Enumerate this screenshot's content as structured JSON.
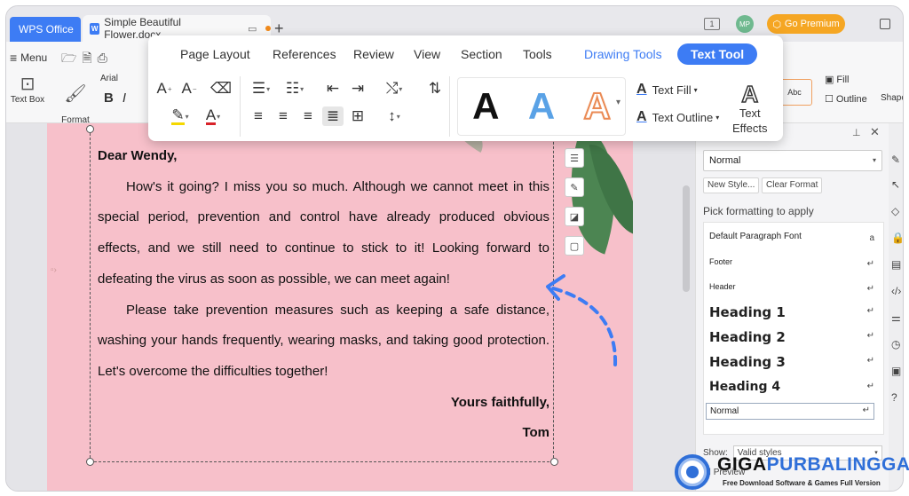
{
  "titlebar": {
    "app_tab": "WPS Office",
    "doc_icon": "W",
    "doc_title": "Simple Beautiful Flower.docx",
    "new_tab": "+",
    "window_count": "1",
    "avatar_initials": "MP",
    "premium_label": "Go Premium"
  },
  "ribbon": {
    "menu_label": "Menu",
    "text_box_label": "Text Box",
    "format_painter_label": "Format\nPainter",
    "font_name": "Arial",
    "abc_label": "Abc",
    "fill_label": "Fill",
    "outline_label": "Outline",
    "shape_label": "Shape"
  },
  "toolbar": {
    "tabs": [
      "Page Layout",
      "References",
      "Review",
      "View",
      "Section",
      "Tools",
      "Drawing Tools",
      "Text Tool"
    ],
    "active_tab": "Text Tool",
    "text_fill_label": "Text Fill",
    "text_outline_label": "Text Outline",
    "text_effects_label": "Text\nEffects",
    "style_glyph": "A"
  },
  "document": {
    "greeting": "Dear Wendy,",
    "paragraphs": [
      "How's it going? I miss you so much. Although we cannot meet in this special period, prevention and control have already produced obvious effects, and we still need to continue to stick to it! Looking forward to defeating the virus as soon as possible, we can meet again!",
      "Please take prevention measures such as keeping a safe distance, washing your hands frequently, wearing masks, and taking good protection. Let's overcome the difficulties together!"
    ],
    "closing": "Yours faithfully,",
    "signature": "Tom"
  },
  "styles_pane": {
    "current_style": "Normal",
    "new_style_label": "New Style...",
    "clear_format_label": "Clear Format",
    "pick_label": "Pick formatting to apply",
    "items": [
      {
        "label": "Default Paragraph Font",
        "mark": "a"
      },
      {
        "label": "Footer",
        "mark": "↵"
      },
      {
        "label": "Header",
        "mark": "↵"
      },
      {
        "label": "Heading 1",
        "mark": "↵"
      },
      {
        "label": "Heading 2",
        "mark": "↵"
      },
      {
        "label": "Heading 3",
        "mark": "↵"
      },
      {
        "label": "Heading 4",
        "mark": "↵"
      },
      {
        "label": "Normal",
        "mark": "↵"
      }
    ],
    "show_label": "Show:",
    "show_value": "Valid styles",
    "preview_label": "Preview"
  },
  "watermark": {
    "brand_a": "GIGA",
    "brand_b": "PURBALINGGA",
    "tagline": "Free Download Software & Games Full Version"
  },
  "colors": {
    "accent": "#3d7cf4",
    "page": "#f7c0ca",
    "premium": "#f5a623",
    "arrow": "#3d7cf4"
  }
}
